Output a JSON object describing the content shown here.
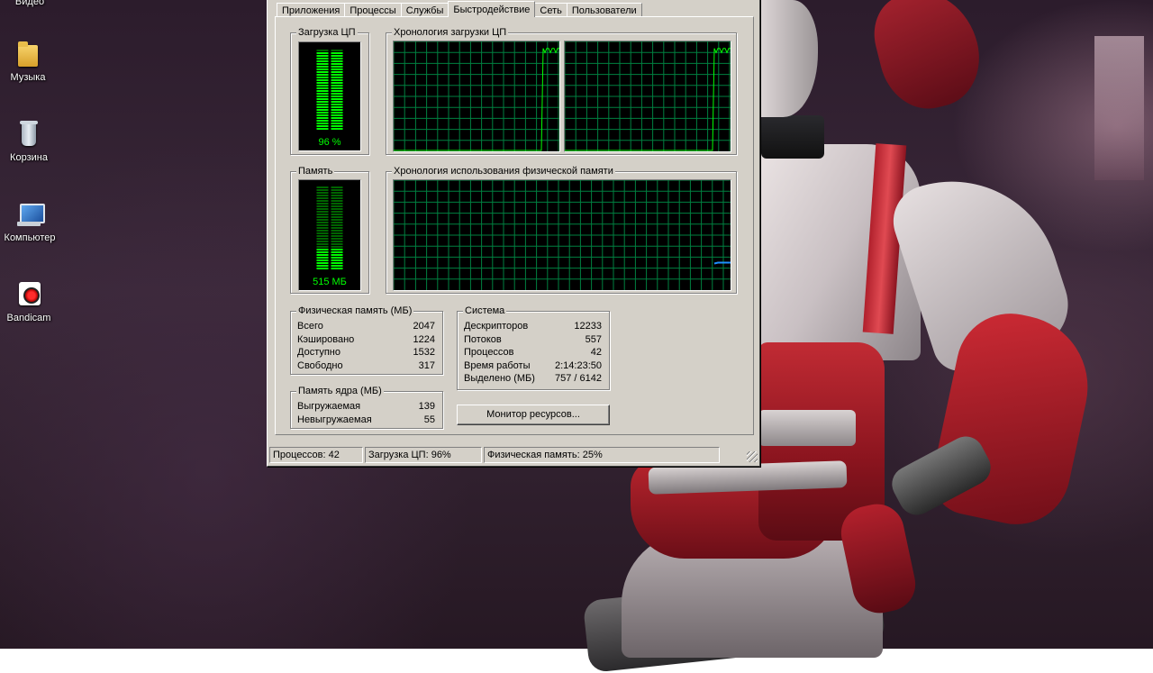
{
  "desktop": {
    "icons": [
      {
        "label": "Видео",
        "icon": "video-folder-icon"
      },
      {
        "label": "Музыка",
        "icon": "folder-icon"
      },
      {
        "label": "Корзина",
        "icon": "recycle-bin-icon"
      },
      {
        "label": "Компьютер",
        "icon": "computer-icon"
      },
      {
        "label": "Bandicam",
        "icon": "bandicam-icon"
      }
    ]
  },
  "tabs": [
    "Приложения",
    "Процессы",
    "Службы",
    "Быстродействие",
    "Сеть",
    "Пользователи"
  ],
  "active_tab": "Быстродействие",
  "cpu": {
    "group_label": "Загрузка ЦП",
    "value_label": "96 %",
    "percent": 96,
    "history_label": "Хронология загрузки ЦП"
  },
  "memory": {
    "group_label": "Память",
    "value_label": "515 МБ",
    "used_fraction": 0.25,
    "history_label": "Хронология использования физической памяти"
  },
  "physical_memory": {
    "title": "Физическая память (МБ)",
    "rows": [
      {
        "label": "Всего",
        "value": "2047"
      },
      {
        "label": "Кэшировано",
        "value": "1224"
      },
      {
        "label": "Доступно",
        "value": "1532"
      },
      {
        "label": "Свободно",
        "value": "317"
      }
    ]
  },
  "kernel_memory": {
    "title": "Память ядра (МБ)",
    "rows": [
      {
        "label": "Выгружаемая",
        "value": "139"
      },
      {
        "label": "Невыгружаемая",
        "value": "55"
      }
    ]
  },
  "system": {
    "title": "Система",
    "rows": [
      {
        "label": "Дескрипторов",
        "value": "12233"
      },
      {
        "label": "Потоков",
        "value": "557"
      },
      {
        "label": "Процессов",
        "value": "42"
      },
      {
        "label": "Время работы",
        "value": "2:14:23:50"
      },
      {
        "label": "Выделено (МБ)",
        "value": "757 / 6142"
      }
    ]
  },
  "resource_monitor_button": "Монитор ресурсов...",
  "status_bar": {
    "processes": "Процессов: 42",
    "cpu": "Загрузка ЦП: 96%",
    "memory": "Физическая память: 25%"
  },
  "colors": {
    "graph_grid": "#008040",
    "graph_line": "#00ff00",
    "memory_line": "#1e90ff",
    "window_face": "#d4d0c8"
  }
}
